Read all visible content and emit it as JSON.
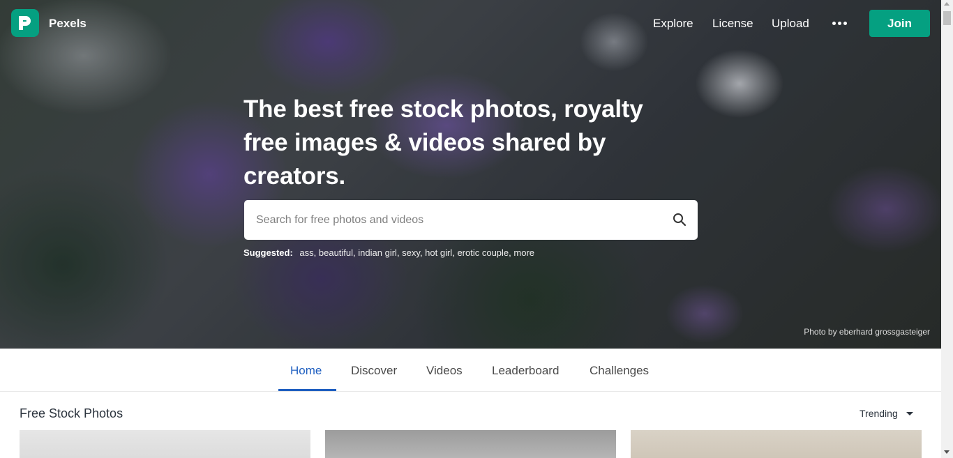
{
  "header": {
    "brand": "Pexels",
    "nav": [
      "Explore",
      "License",
      "Upload"
    ],
    "join_label": "Join"
  },
  "hero": {
    "headline": "The best free stock photos, royalty free images & videos shared by creators.",
    "search_placeholder": "Search for free photos and videos",
    "suggested_label": "Suggested:",
    "suggested": [
      "ass",
      "beautiful",
      "indian girl",
      "sexy",
      "hot girl",
      "erotic couple",
      "more"
    ],
    "photo_credit": "Photo by eberhard grossgasteiger"
  },
  "tabs": [
    "Home",
    "Discover",
    "Videos",
    "Leaderboard",
    "Challenges"
  ],
  "active_tab": "Home",
  "section": {
    "title": "Free Stock Photos",
    "sort_label": "Trending"
  },
  "colors": {
    "brand": "#05a081",
    "active_tab": "#1f5fc0"
  }
}
